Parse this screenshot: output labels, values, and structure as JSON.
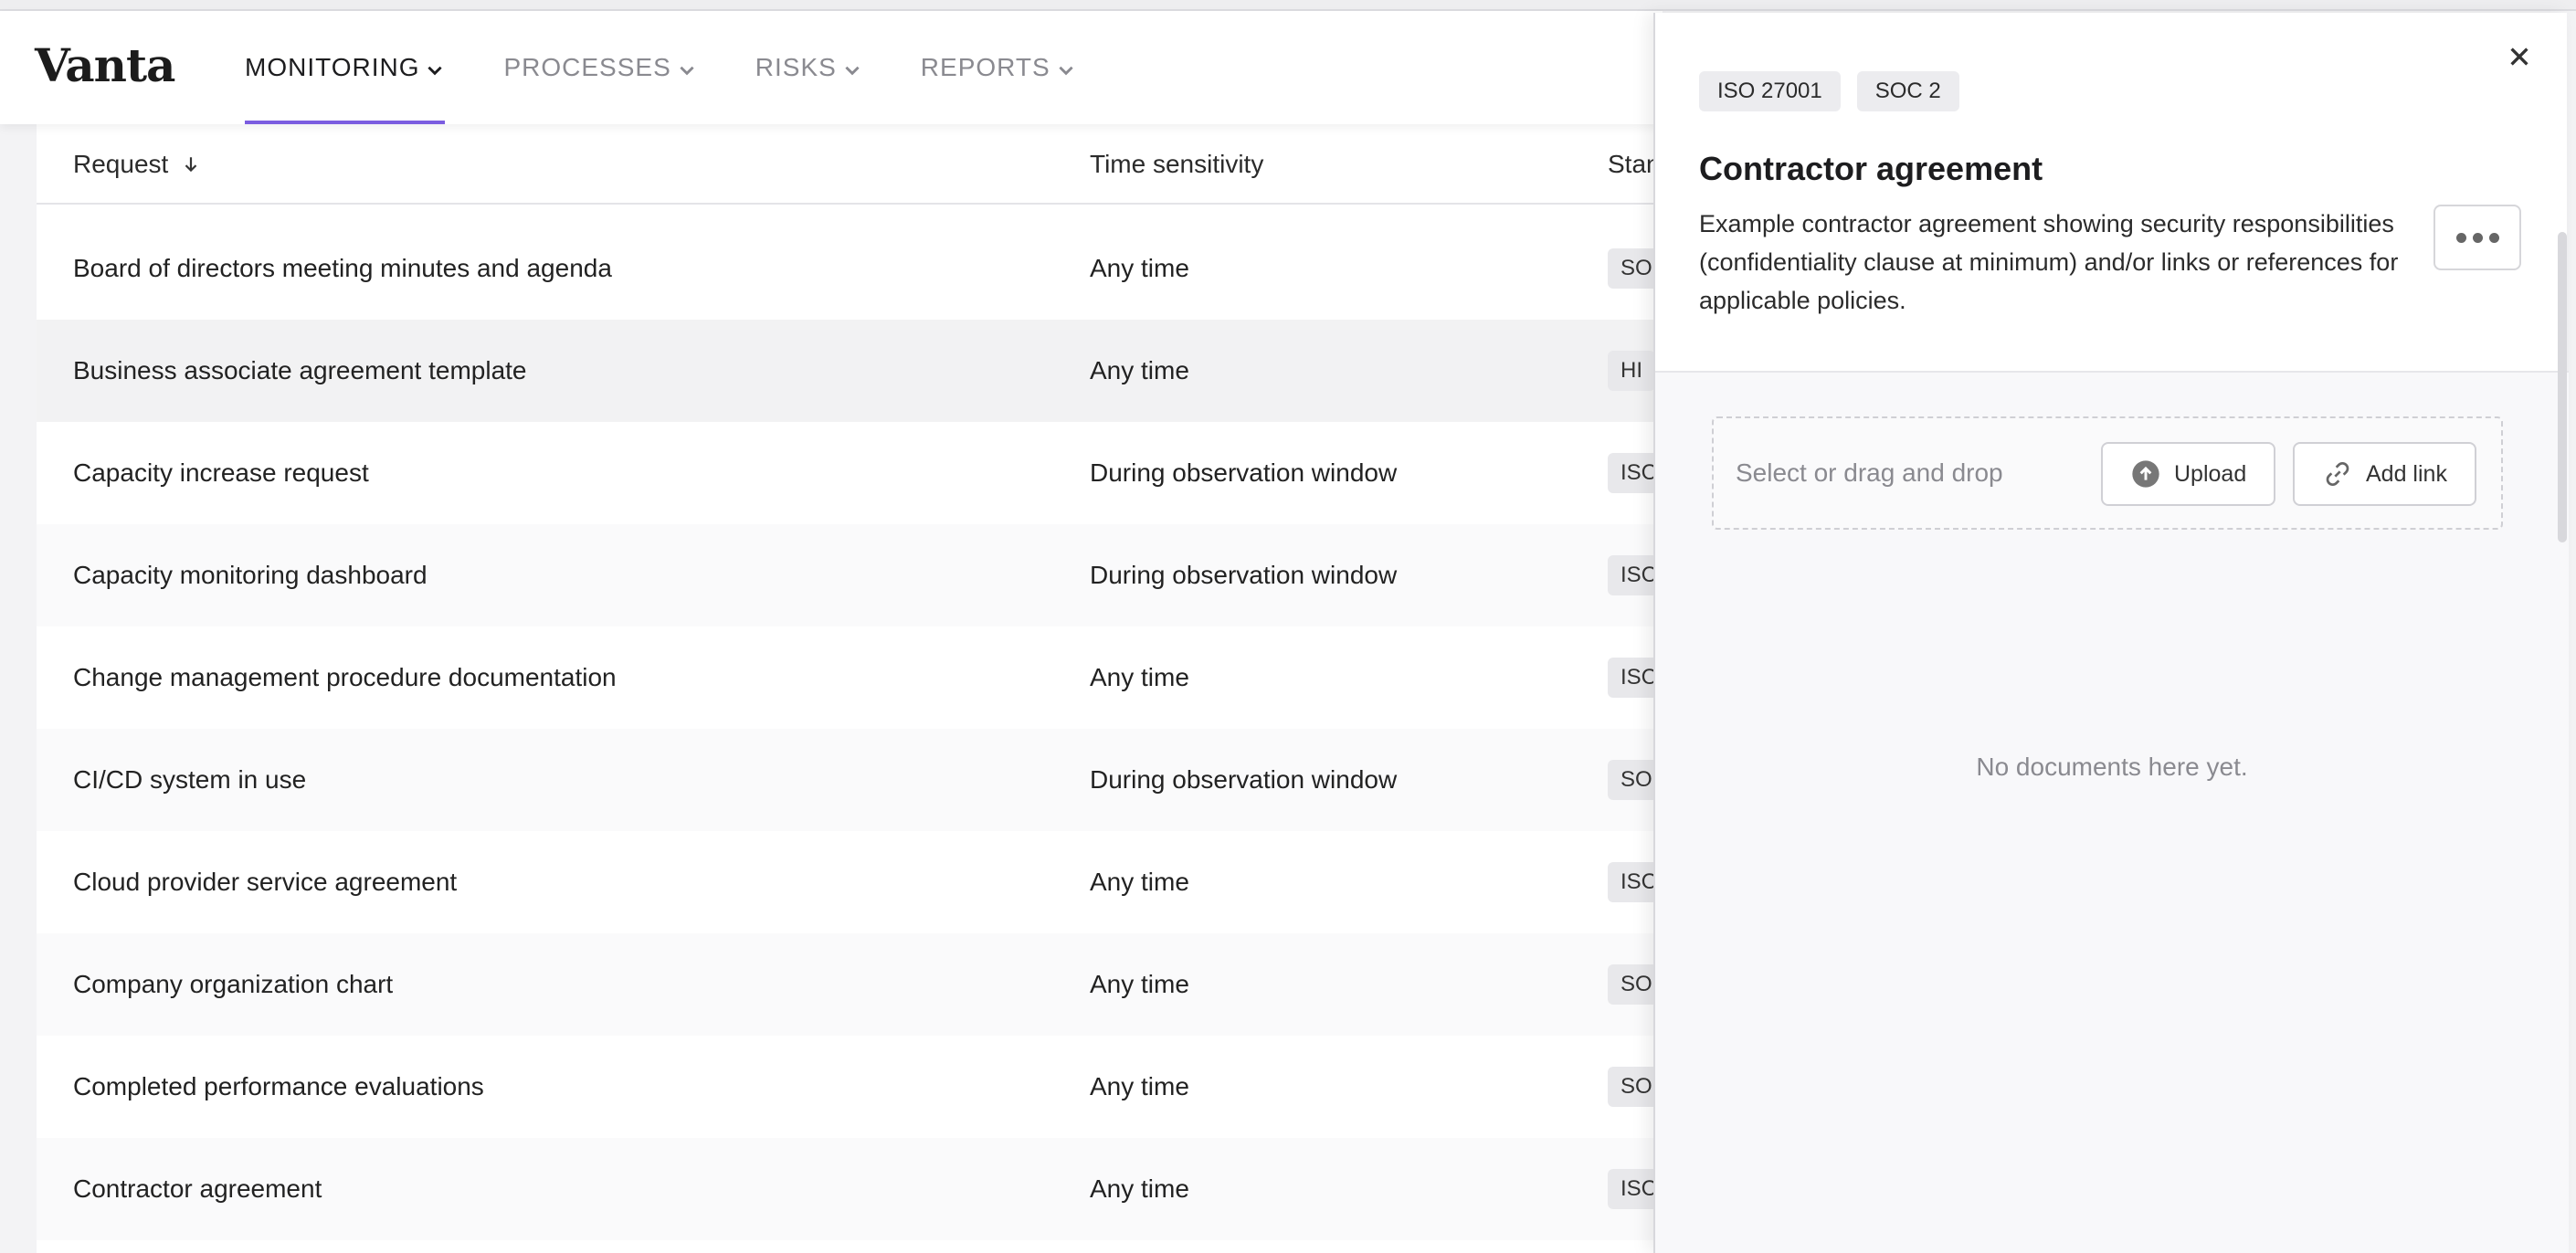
{
  "app": {
    "logo": "Vanta"
  },
  "nav": {
    "items": [
      {
        "label": "MONITORING",
        "active": true
      },
      {
        "label": "PROCESSES",
        "active": false
      },
      {
        "label": "RISKS",
        "active": false
      },
      {
        "label": "REPORTS",
        "active": false
      }
    ]
  },
  "table": {
    "headers": {
      "request": "Request",
      "time": "Time sensitivity",
      "standard": "Stan"
    },
    "rows": [
      {
        "request": "Board of directors meeting minutes and agenda",
        "time": "Any time",
        "standard": "SO"
      },
      {
        "request": "Business associate agreement template",
        "time": "Any time",
        "standard": "HI"
      },
      {
        "request": "Capacity increase request",
        "time": "During observation window",
        "standard": "ISC"
      },
      {
        "request": "Capacity monitoring dashboard",
        "time": "During observation window",
        "standard": "ISC"
      },
      {
        "request": "Change management procedure documentation",
        "time": "Any time",
        "standard": "ISC"
      },
      {
        "request": "CI/CD system in use",
        "time": "During observation window",
        "standard": "SO"
      },
      {
        "request": "Cloud provider service agreement",
        "time": "Any time",
        "standard": "ISC"
      },
      {
        "request": "Company organization chart",
        "time": "Any time",
        "standard": "SO"
      },
      {
        "request": "Completed performance evaluations",
        "time": "Any time",
        "standard": "SO"
      },
      {
        "request": "Contractor agreement",
        "time": "Any time",
        "standard": "ISC"
      }
    ]
  },
  "drawer": {
    "tags": [
      "ISO 27001",
      "SOC 2"
    ],
    "title": "Contractor agreement",
    "description": "Example contractor agreement showing security responsibilities (confidentiality clause at minimum) and/or links or references for applicable policies.",
    "dropzone": {
      "text": "Select or drag and drop",
      "upload_label": "Upload",
      "add_link_label": "Add link"
    },
    "empty_text": "No documents here yet."
  },
  "colors": {
    "accent": "#7b5de0"
  }
}
